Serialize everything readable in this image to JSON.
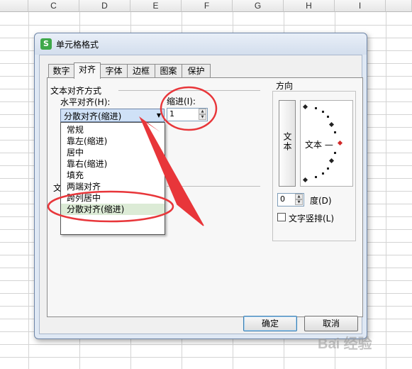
{
  "sheet": {
    "columns": [
      "C",
      "D",
      "E",
      "F",
      "G",
      "H",
      "I"
    ]
  },
  "dialog": {
    "title": "单元格格式",
    "tabs": [
      "数字",
      "对齐",
      "字体",
      "边框",
      "图案",
      "保护"
    ],
    "active_tab": "对齐",
    "text_align_group": "文本对齐方式",
    "horizontal_label": "水平对齐(H):",
    "horizontal_value": "分散对齐(缩进)",
    "indent_label": "缩进(I):",
    "indent_value": "1",
    "dropdown_options": [
      "常规",
      "靠左(缩进)",
      "居中",
      "靠右(缩进)",
      "填充",
      "两端对齐",
      "跨列居中",
      "分散对齐(缩进)"
    ],
    "selected_option_index": 7,
    "hidden_label_fragment": "文",
    "direction_group": "方向",
    "vertical_text_button": "文本",
    "dial_label": "文本 —",
    "degree_value": "0",
    "degree_label": "度(D)",
    "vertical_text_checkbox": "文字竖排(L)",
    "ok_button": "确定",
    "cancel_button": "取消"
  },
  "annotation_color": "#e8363a",
  "watermark": "Bai 经验"
}
